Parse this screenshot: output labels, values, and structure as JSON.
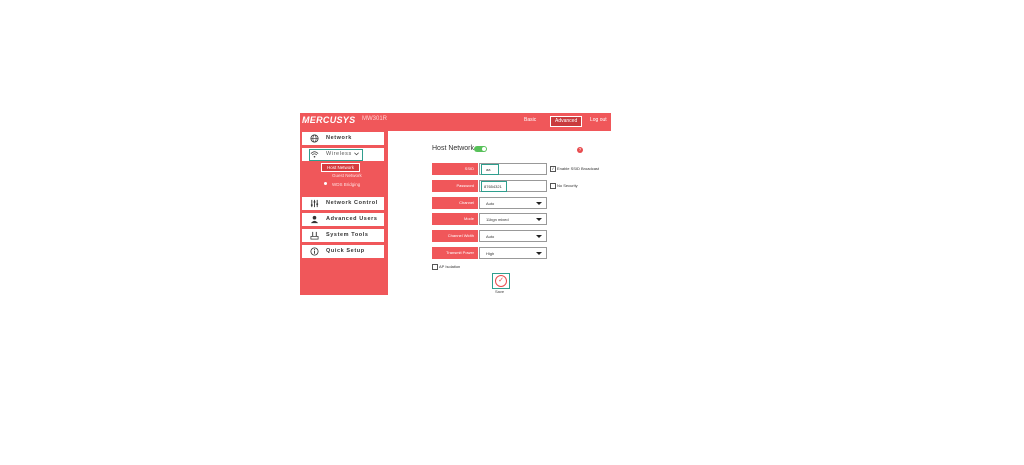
{
  "header": {
    "logo": "MERCUSYS",
    "model": "MW301R",
    "tabs": [
      "Basic",
      "Advanced",
      "Log out"
    ],
    "active_tab": "Advanced"
  },
  "sidebar": {
    "items": [
      {
        "label": "Network",
        "icon": "globe-icon"
      },
      {
        "label": "Wireless",
        "icon": "wifi-icon"
      },
      {
        "label": "Network Control",
        "icon": "sliders-icon"
      },
      {
        "label": "Advanced Users",
        "icon": "user-icon"
      },
      {
        "label": "System Tools",
        "icon": "tools-icon"
      },
      {
        "label": "Quick Setup",
        "icon": "info-icon"
      }
    ],
    "wireless_sub": [
      "Host Network",
      "Guest Network",
      "WDS Bridging"
    ]
  },
  "main": {
    "title": "Host Network",
    "toggle_on": true,
    "fields": [
      {
        "label": "SSID",
        "value": "aa"
      },
      {
        "label": "Password",
        "value": "87654321"
      },
      {
        "label": "Channel",
        "value": "Auto"
      },
      {
        "label": "Mode",
        "value": "11bgn mixed"
      },
      {
        "label": "Channel Width",
        "value": "Auto"
      },
      {
        "label": "Transmit Power",
        "value": "High"
      }
    ],
    "enable_ssid_broadcast": "Enable SSID Broadcast",
    "no_security": "No Security",
    "ap_isolation": "AP Isolation",
    "save_label": "Save",
    "help": "?"
  },
  "colors": {
    "brand": "#f0575a",
    "highlight": "#2f9e8e"
  }
}
